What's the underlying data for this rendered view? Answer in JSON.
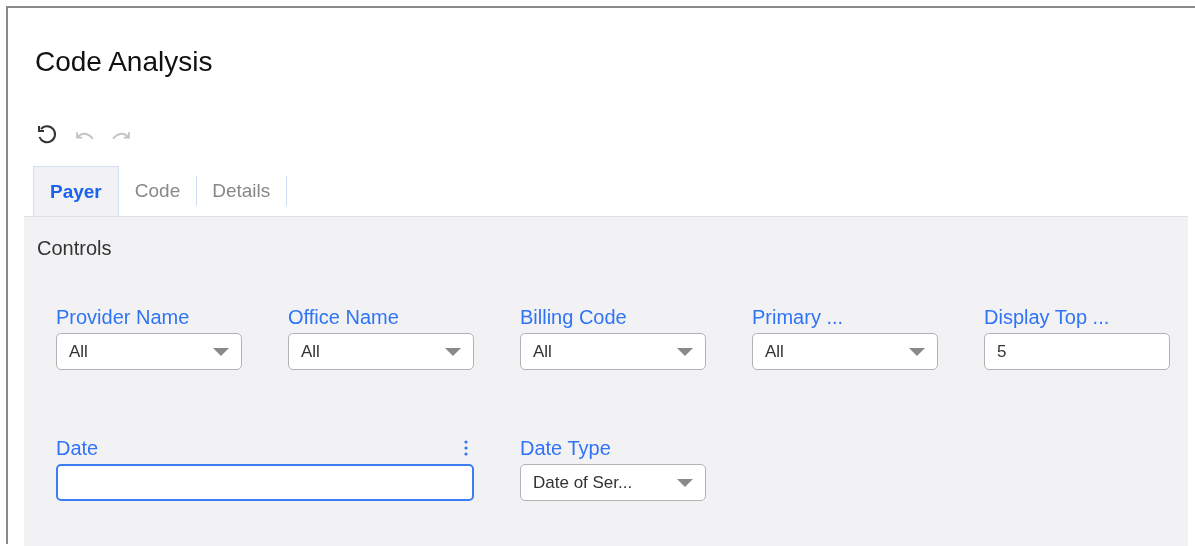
{
  "window": {
    "title": "Code Analysis"
  },
  "toolbar": [
    {
      "kind": "reset",
      "disabled": false
    },
    {
      "kind": "undo",
      "disabled": true
    },
    {
      "kind": "redo",
      "disabled": true
    }
  ],
  "tabs": [
    {
      "label": "Payer",
      "selected": true
    },
    {
      "label": "Code",
      "selected": false
    },
    {
      "label": "Details",
      "selected": false
    }
  ],
  "panel": {
    "title": "Controls"
  },
  "controls": [
    {
      "kind": "dropdown",
      "label": "Provider Name",
      "value": "All"
    },
    {
      "kind": "dropdown",
      "label": "Office Name",
      "value": "All"
    },
    {
      "kind": "dropdown",
      "label": "Billing Code",
      "value": "All"
    },
    {
      "kind": "dropdown",
      "label": "Primary ...",
      "value": "All"
    },
    {
      "kind": "text",
      "label": "Display Top ...",
      "value": "5"
    },
    {
      "kind": "date",
      "label": "Date",
      "focused": true
    },
    {
      "kind": "dropdown",
      "label": "Date Type",
      "value": "Date of Ser..."
    }
  ]
}
